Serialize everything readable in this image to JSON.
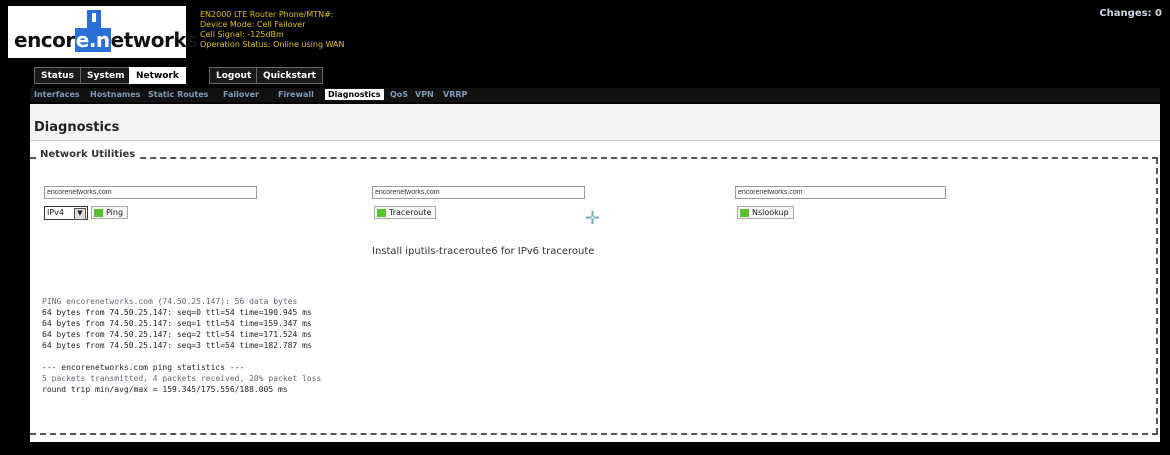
{
  "header": {
    "logo_text_prefix": "encor",
    "logo_text_highlight": "e.n",
    "logo_text_suffix": "etworks",
    "device_line1": "EN2000 LTE Router Phone/MTN#:",
    "device_line2": "Device Mode: Cell Failover",
    "device_line3": "Cell Signal: -125dBm",
    "device_line4": "Operation Status: Online using WAN",
    "changes": "Changes: 0"
  },
  "top_tabs": [
    "Status",
    "System",
    "Network",
    "Logout",
    "Quickstart"
  ],
  "active_top_tab": "Network",
  "subnav": [
    "Interfaces",
    "Hostnames",
    "Static Routes",
    "Failover",
    "Firewall",
    "Diagnostics",
    "QoS",
    "VPN",
    "VRRP"
  ],
  "active_subnav": "Diagnostics",
  "page": {
    "title": "Diagnostics",
    "fieldset_legend": "Network Utilities"
  },
  "tools": {
    "ping_host": "encorenetworks.com",
    "ping_protocol": "IPv4",
    "ping_button": "Ping",
    "traceroute_host": "encorenetworks.com",
    "traceroute_button": "Traceroute",
    "nslookup_host": "encorenetworks.com",
    "nslookup_button": "Nslookup",
    "traceroute_note": "Install iputils-traceroute6 for IPv6 traceroute"
  },
  "output": {
    "line1": "PING encorenetworks.com (74.50.25.147): 56 data bytes",
    "line2": "64 bytes from 74.50.25.147: seq=0 ttl=54 time=190.945 ms",
    "line3": "64 bytes from 74.50.25.147: seq=1 ttl=54 time=159.347 ms",
    "line4": "64 bytes from 74.50.25.147: seq=2 ttl=54 time=171.524 ms",
    "line5": "64 bytes from 74.50.25.147: seq=3 ttl=54 time=182.787 ms",
    "line6": "--- encorenetworks.com ping statistics ---",
    "line7": "5 packets transmitted, 4 packets received, 20% packet loss",
    "line8": "round trip min/avg/max = 159.345/175.556/188.005 ms"
  }
}
